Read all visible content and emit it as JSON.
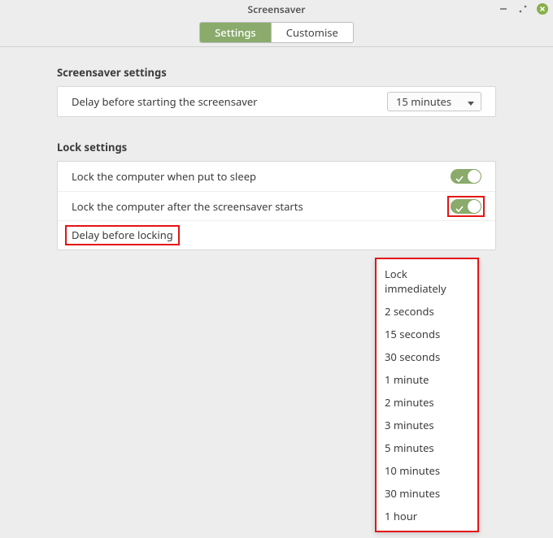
{
  "window": {
    "title": "Screensaver"
  },
  "tabs": {
    "settings": "Settings",
    "customise": "Customise"
  },
  "sections": {
    "screensaver_title": "Screensaver settings",
    "lock_title": "Lock settings"
  },
  "screensaver": {
    "delay_label": "Delay before starting the screensaver",
    "delay_value": "15 minutes"
  },
  "lock": {
    "sleep_label": "Lock the computer when put to sleep",
    "sleep_on": true,
    "after_ss_label": "Lock the computer after the screensaver starts",
    "after_ss_on": true,
    "delay_label": "Delay before locking"
  },
  "delay_options": [
    "Lock immediately",
    "2 seconds",
    "15 seconds",
    "30 seconds",
    "1 minute",
    "2 minutes",
    "3 minutes",
    "5 minutes",
    "10 minutes",
    "30 minutes",
    "1 hour"
  ]
}
